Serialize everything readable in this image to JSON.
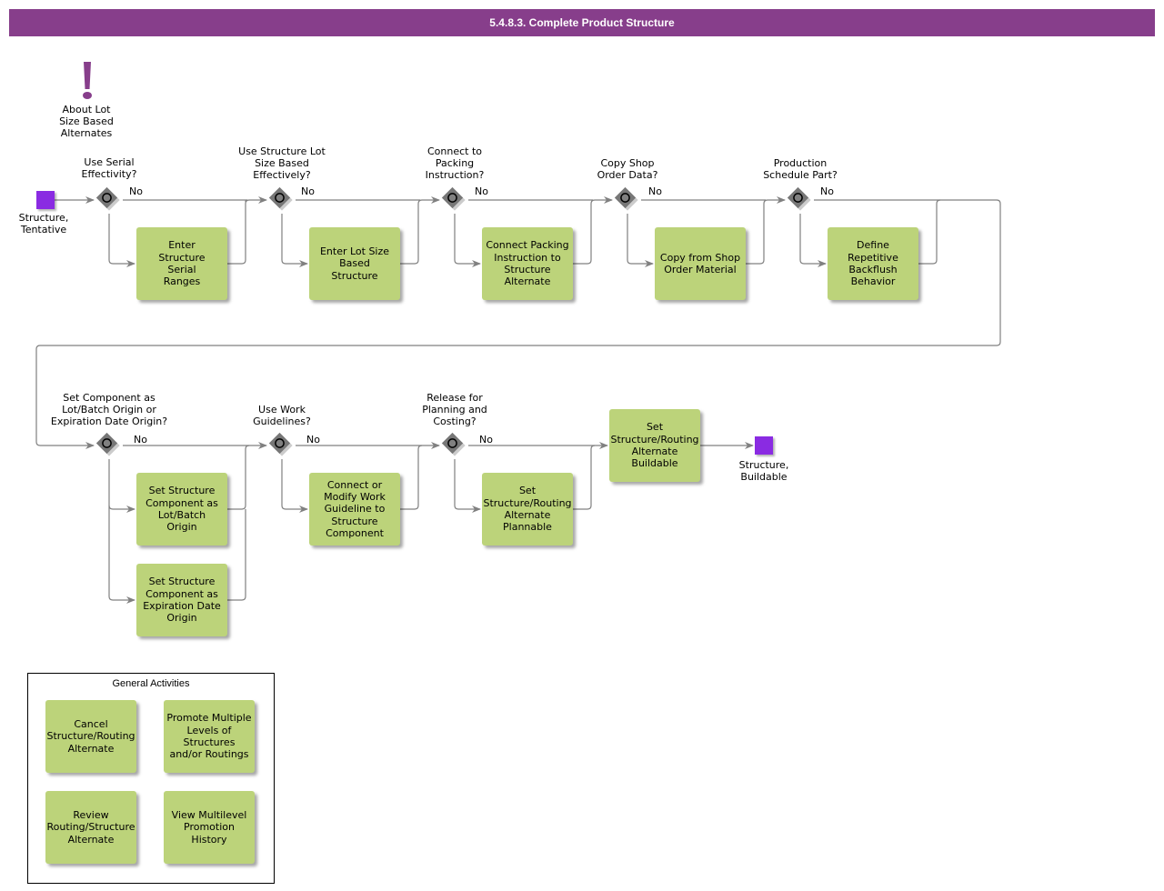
{
  "title": "5.4.8.3. Complete Product Structure",
  "colors": {
    "title_bar": "#873e8b",
    "task": "#bcd37a",
    "event": "#8a2be2",
    "gateway": "#777777",
    "annotation": "#873e8b"
  },
  "annotation": {
    "icon": "exclamation-icon",
    "label": "About Lot\nSize Based\nAlternates"
  },
  "events": {
    "start": {
      "label": "Structure,\nTentative"
    },
    "end": {
      "label": "Structure,\nBuildable"
    }
  },
  "gateways": [
    {
      "question": "Use Serial\nEffectivity?",
      "branch_label": "No"
    },
    {
      "question": "Use Structure Lot\nSize Based\nEffectively?",
      "branch_label": "No"
    },
    {
      "question": "Connect to\nPacking\nInstruction?",
      "branch_label": "No"
    },
    {
      "question": "Copy Shop\nOrder Data?",
      "branch_label": "No"
    },
    {
      "question": "Production\nSchedule Part?",
      "branch_label": "No"
    },
    {
      "question": "Set Component as\nLot/Batch Origin or\nExpiration Date Origin?",
      "branch_label": "No"
    },
    {
      "question": "Use Work\nGuidelines?",
      "branch_label": "No"
    },
    {
      "question": "Release for\nPlanning and\nCosting?",
      "branch_label": "No"
    }
  ],
  "tasks": [
    {
      "label": "Enter\nStructure\nSerial\nRanges"
    },
    {
      "label": "Enter Lot Size\nBased\nStructure"
    },
    {
      "label": "Connect Packing\nInstruction to\nStructure\nAlternate"
    },
    {
      "label": "Copy from Shop\nOrder Material"
    },
    {
      "label": "Define\nRepetitive\nBackflush\nBehavior"
    },
    {
      "label": "Set Structure\nComponent as\nLot/Batch\nOrigin"
    },
    {
      "label": "Set Structure\nComponent as\nExpiration Date\nOrigin"
    },
    {
      "label": "Connect or\nModify Work\nGuideline to\nStructure\nComponent"
    },
    {
      "label": "Set\nStructure/Routing\nAlternate\nPlannable"
    },
    {
      "label": "Set\nStructure/Routing\nAlternate\nBuildable"
    }
  ],
  "general_activities": {
    "title": "General Activities",
    "items": [
      {
        "label": "Cancel\nStructure/Routing\nAlternate"
      },
      {
        "label": "Promote Multiple\nLevels of\nStructures\nand/or Routings"
      },
      {
        "label": "Review\nRouting/Structure\nAlternate"
      },
      {
        "label": "View Multilevel\nPromotion\nHistory"
      }
    ]
  }
}
